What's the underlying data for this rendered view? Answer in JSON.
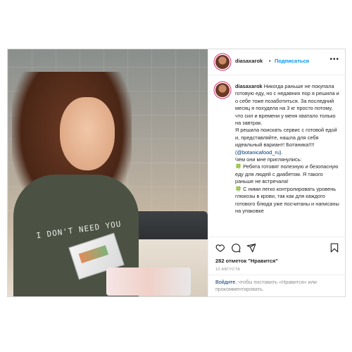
{
  "post": {
    "username": "diasaxarok",
    "follow_label": "Подписаться",
    "separator": "•",
    "more_label": "•••",
    "photo_shirt_text": "I DON'T NEED YOU",
    "caption": {
      "username": "diasaxarok",
      "p1": "Никогда раньше не покупала готовую еду, но с недавних пор я решила и о себе тоже позаботиться. За последний месяц я похудела на 3 кг просто потому, что сил и времени у меня хватало только на завтрак.",
      "p2": "Я решила поискать сервис с готовой едой и, представляйте, нашла для себя идеальный вариант! Ботаника!!!!",
      "link": "(@botanicafood_ru).",
      "p3": "Чем они мне приглянулись:",
      "leaf": "🍀",
      "b1": "Ребята готовят полезную и безопасную еду для людей с диабетом. Я такого раньше не встречала!",
      "b2": "С ними легко контролировать уровень глюкозы в крови, так как для каждого готового блюда уже посчитаны и написаны на упаковке"
    },
    "likes_count": "282 отметок",
    "likes_label": "\"Нравится\"",
    "date": "10 АВГУСТА",
    "comment_prompt": {
      "login": "Войдите",
      "rest": ", чтобы поставить «Нравится» или прокомментировать."
    }
  },
  "icons": [
    "heart-icon",
    "comment-icon",
    "share-icon",
    "bookmark-icon",
    "more-icon"
  ],
  "colors": {
    "link_blue": "#0095f6",
    "text": "#262626",
    "muted": "#8e8e8e",
    "border": "#dbdbdb"
  }
}
